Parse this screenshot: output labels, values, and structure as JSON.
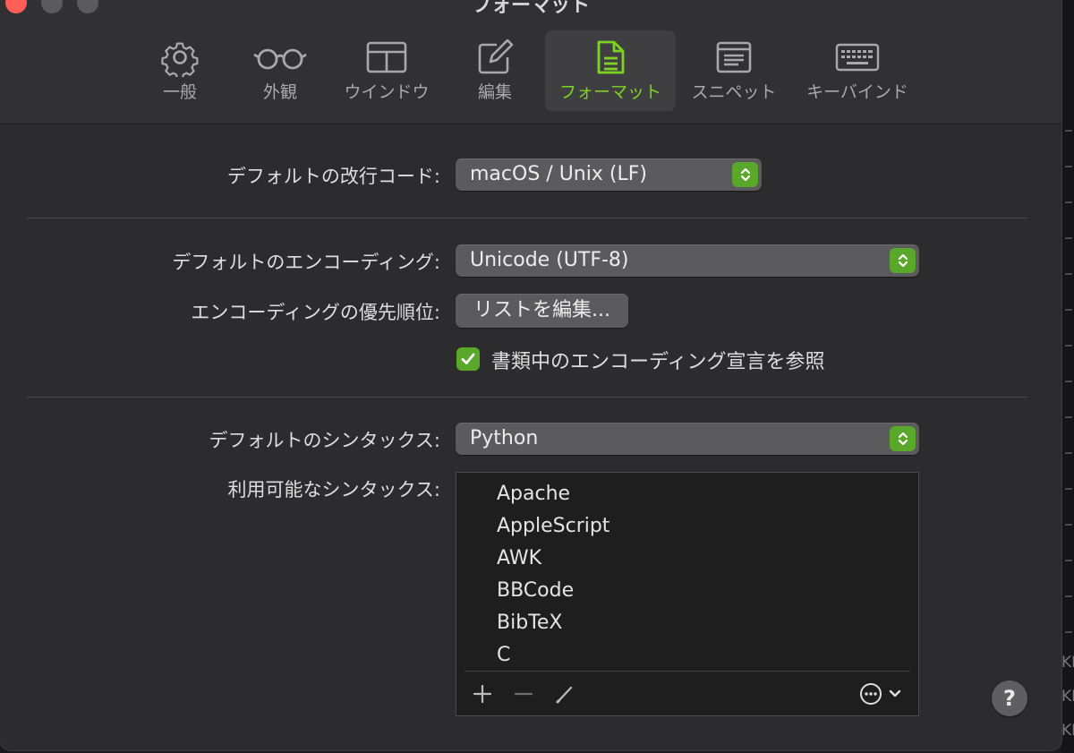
{
  "window": {
    "title": "フォーマット"
  },
  "colors": {
    "accent": "#7ed321",
    "control_green": "#5aa82a",
    "window_bg": "#2c2c2e"
  },
  "tabs": [
    {
      "label": "一般",
      "icon": "gear-icon"
    },
    {
      "label": "外観",
      "icon": "glasses-icon"
    },
    {
      "label": "ウインドウ",
      "icon": "window-icon"
    },
    {
      "label": "編集",
      "icon": "edit-icon"
    },
    {
      "label": "フォーマット",
      "icon": "document-icon",
      "selected": true
    },
    {
      "label": "スニペット",
      "icon": "snippet-icon"
    },
    {
      "label": "キーバインド",
      "icon": "keyboard-icon"
    }
  ],
  "line_ending": {
    "label": "デフォルトの改行コード:",
    "value": "macOS / Unix (LF)"
  },
  "encoding": {
    "label": "デフォルトのエンコーディング:",
    "value": "Unicode (UTF-8)",
    "priority_label": "エンコーディングの優先順位:",
    "edit_list_button": "リストを編集...",
    "refer_declaration_label": "書類中のエンコーディング宣言を参照",
    "refer_declaration_checked": true
  },
  "syntax": {
    "default_label": "デフォルトのシンタックス:",
    "default_value": "Python",
    "available_label": "利用可能なシンタックス:",
    "available": [
      "Apache",
      "AppleScript",
      "AWK",
      "BBCode",
      "BibTeX",
      "C"
    ]
  },
  "list_footer": {
    "add": "+",
    "remove": "−"
  },
  "help": {
    "label": "?"
  },
  "background_text": [
    "KE",
    "KE",
    "KE"
  ]
}
